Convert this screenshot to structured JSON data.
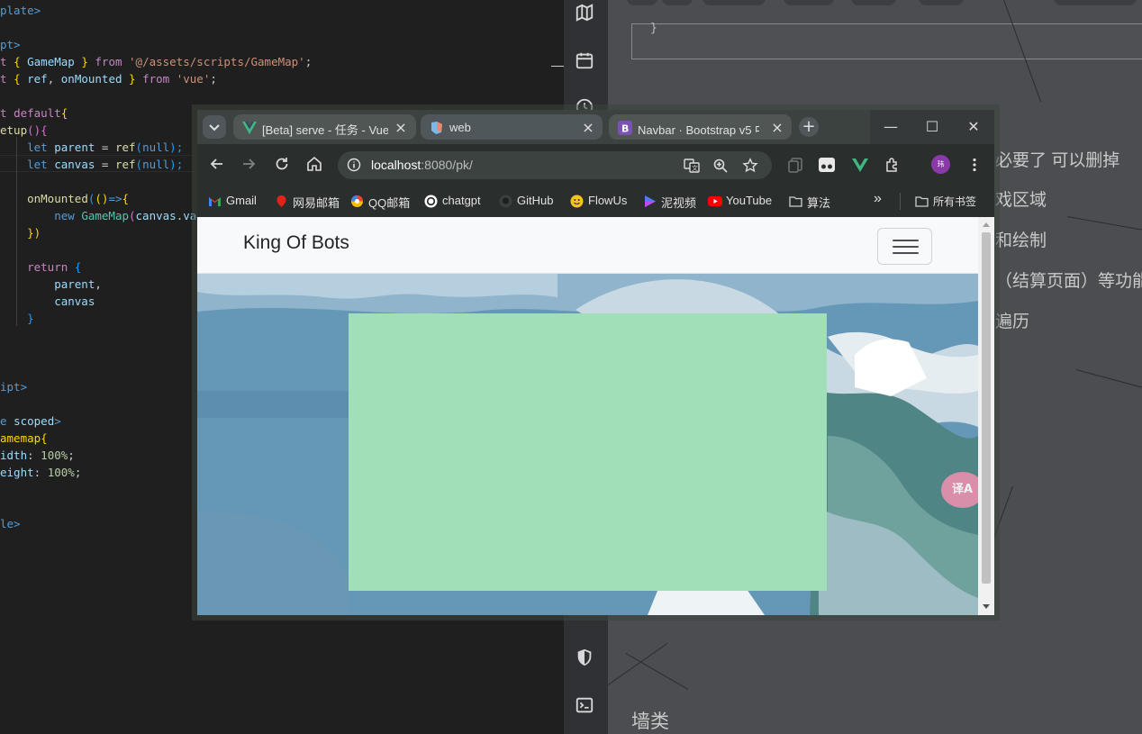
{
  "editor": {
    "lines": [
      [
        [
          "plate>",
          "tk-tag"
        ]
      ],
      [],
      [
        [
          "pt>",
          "tk-tag"
        ]
      ],
      [
        [
          "t ",
          "tk-kw"
        ],
        [
          "{ ",
          "tk-brk"
        ],
        [
          "GameMap",
          "tk-var"
        ],
        [
          " } ",
          "tk-brk"
        ],
        [
          "from ",
          "tk-kw"
        ],
        [
          "'@/assets/scripts/GameMap'",
          "tk-str"
        ],
        [
          ";",
          "tk-pl"
        ]
      ],
      [
        [
          "t ",
          "tk-kw"
        ],
        [
          "{ ",
          "tk-brk"
        ],
        [
          "ref",
          "tk-var"
        ],
        [
          ", ",
          "tk-pl"
        ],
        [
          "onMounted",
          "tk-var"
        ],
        [
          " } ",
          "tk-brk"
        ],
        [
          "from ",
          "tk-kw"
        ],
        [
          "'vue'",
          "tk-str"
        ],
        [
          ";",
          "tk-pl"
        ]
      ],
      [],
      [
        [
          "t ",
          "tk-kw"
        ],
        [
          "default",
          "tk-kw"
        ],
        [
          "{",
          "tk-brk"
        ]
      ],
      [
        [
          "etup",
          "tk-fn"
        ],
        [
          "()",
          "tk-brk2"
        ],
        [
          "{",
          "tk-brk2"
        ]
      ],
      [
        [
          "    let ",
          "tk-tag"
        ],
        [
          "parent",
          "tk-var"
        ],
        [
          " = ",
          "tk-pl"
        ],
        [
          "ref",
          "tk-fn"
        ],
        [
          "(",
          "tk-brk3"
        ],
        [
          "null",
          "tk-tag"
        ],
        [
          ");",
          "tk-brk3"
        ]
      ],
      [
        [
          "    let ",
          "tk-tag"
        ],
        [
          "canvas",
          "tk-var"
        ],
        [
          " = ",
          "tk-pl"
        ],
        [
          "ref",
          "tk-fn"
        ],
        [
          "(",
          "tk-brk3"
        ],
        [
          "null",
          "tk-tag"
        ],
        [
          ");",
          "tk-brk3"
        ]
      ],
      [],
      [
        [
          "    ",
          "tk-pl"
        ],
        [
          "onMounted",
          "tk-fn"
        ],
        [
          "(",
          "tk-brk3"
        ],
        [
          "()",
          "tk-brk"
        ],
        [
          "=>",
          "tk-tag"
        ],
        [
          "{",
          "tk-brk"
        ]
      ],
      [
        [
          "        new ",
          "tk-tag"
        ],
        [
          "GameMap",
          "tk-cls"
        ],
        [
          "(",
          "tk-brk2"
        ],
        [
          "canvas",
          "tk-var"
        ],
        [
          ".val",
          "tk-var"
        ]
      ],
      [
        [
          "    })",
          "tk-brk"
        ]
      ],
      [],
      [
        [
          "    return ",
          "tk-kw"
        ],
        [
          "{",
          "tk-brk3"
        ]
      ],
      [
        [
          "        parent",
          "tk-var"
        ],
        [
          ",",
          "tk-pl"
        ]
      ],
      [
        [
          "        canvas",
          "tk-var"
        ]
      ],
      [
        [
          "    }",
          "tk-brk3"
        ]
      ],
      [],
      [],
      [],
      [
        [
          "ipt>",
          "tk-tag"
        ]
      ],
      [],
      [
        [
          "e ",
          "tk-tag"
        ],
        [
          "scoped",
          "tk-var"
        ],
        [
          ">",
          "tk-tag"
        ]
      ],
      [
        [
          "amemap",
          "tk-brk"
        ],
        [
          "{",
          "tk-brk"
        ]
      ],
      [
        [
          "idth",
          "tk-prop"
        ],
        [
          ": ",
          "tk-pl"
        ],
        [
          "100%",
          "tk-num"
        ],
        [
          ";",
          "tk-pl"
        ]
      ],
      [
        [
          "eight",
          "tk-prop"
        ],
        [
          ": ",
          "tk-pl"
        ],
        [
          "100%",
          "tk-num"
        ],
        [
          ";",
          "tk-pl"
        ]
      ],
      [],
      [],
      [
        [
          "le>",
          "tk-tag"
        ]
      ]
    ]
  },
  "right_app": {
    "code_box_text": "}",
    "texts": [
      "必要了 可以删掉",
      "戏区域",
      "和绘制",
      "（结算页面）等功能",
      "遍历",
      "墙类"
    ]
  },
  "browser": {
    "tabs": [
      {
        "title": "[Beta] serve - 任务 - Vue",
        "favicon": "vue-icon",
        "active": false
      },
      {
        "title": "web",
        "favicon": "vue-cli-icon",
        "active": true
      },
      {
        "title": "Navbar · Bootstrap v5 中",
        "favicon": "bootstrap-icon",
        "active": false
      }
    ],
    "new_tab_label": "+",
    "url": "localhost:8080/pk/",
    "url_host": "localhost",
    "url_rest": ":8080/pk/",
    "profile_initial": "玮",
    "bookmarks": [
      {
        "label": "Gmail",
        "icon": "gmail-icon"
      },
      {
        "label": "网易邮箱",
        "icon": "netease-mail-icon"
      },
      {
        "label": "QQ邮箱",
        "icon": "qq-mail-icon"
      },
      {
        "label": "chatgpt",
        "icon": "openai-icon"
      },
      {
        "label": "GitHub",
        "icon": "github-icon"
      },
      {
        "label": "FlowUs",
        "icon": "flowus-icon"
      },
      {
        "label": "泥视频",
        "icon": "video-play-icon"
      },
      {
        "label": "YouTube",
        "icon": "youtube-icon"
      },
      {
        "label": "算法",
        "icon": "folder-icon"
      }
    ],
    "overflow_label": "»",
    "all_bookmarks_label": "所有书签"
  },
  "page": {
    "brand": "King Of Bots",
    "game_area_color": "#a0dfb7",
    "translate_badge": "译A"
  },
  "colors": {
    "editor_bg": "#1f1f1f",
    "browser_chrome": "#2a2e2d",
    "navbar_bg": "#f8f9fa",
    "game_area": "#a0dfb7"
  }
}
